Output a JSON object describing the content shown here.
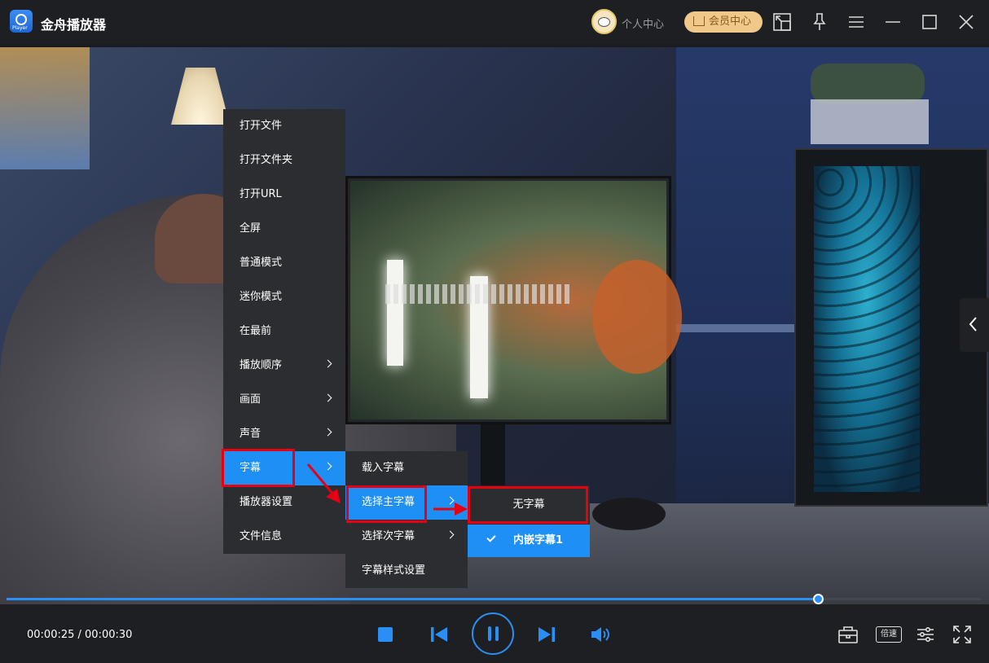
{
  "app": {
    "title": "金舟播放器",
    "logo_text": "Player"
  },
  "header": {
    "user_center": "个人中心",
    "vip_center": "会员中心"
  },
  "main_menu": [
    {
      "label": "打开文件",
      "has_submenu": false
    },
    {
      "label": "打开文件夹",
      "has_submenu": false
    },
    {
      "label": "打开URL",
      "has_submenu": false
    },
    {
      "label": "全屏",
      "has_submenu": false
    },
    {
      "label": "普通模式",
      "has_submenu": false
    },
    {
      "label": "迷你模式",
      "has_submenu": false
    },
    {
      "label": "在最前",
      "has_submenu": false
    },
    {
      "label": "播放顺序",
      "has_submenu": true
    },
    {
      "label": "画面",
      "has_submenu": true
    },
    {
      "label": "声音",
      "has_submenu": true
    },
    {
      "label": "字幕",
      "has_submenu": true,
      "active": true
    },
    {
      "label": "播放器设置",
      "has_submenu": false
    },
    {
      "label": "文件信息",
      "has_submenu": false
    }
  ],
  "subtitle_menu": [
    {
      "label": "载入字幕",
      "has_submenu": false
    },
    {
      "label": "选择主字幕",
      "has_submenu": true,
      "active": true
    },
    {
      "label": "选择次字幕",
      "has_submenu": true
    },
    {
      "label": "字幕样式设置",
      "has_submenu": false
    }
  ],
  "main_subtitle_menu": [
    {
      "label": "无字幕",
      "checked": false
    },
    {
      "label": "内嵌字幕1",
      "checked": true
    }
  ],
  "player": {
    "time_display": "00:00:25 / 00:00:30",
    "progress": 0.833,
    "speed_label": "倍速"
  },
  "colors": {
    "accent": "#1e8ff5",
    "highlight": "#e60012",
    "menu_bg": "#2c2d30"
  }
}
